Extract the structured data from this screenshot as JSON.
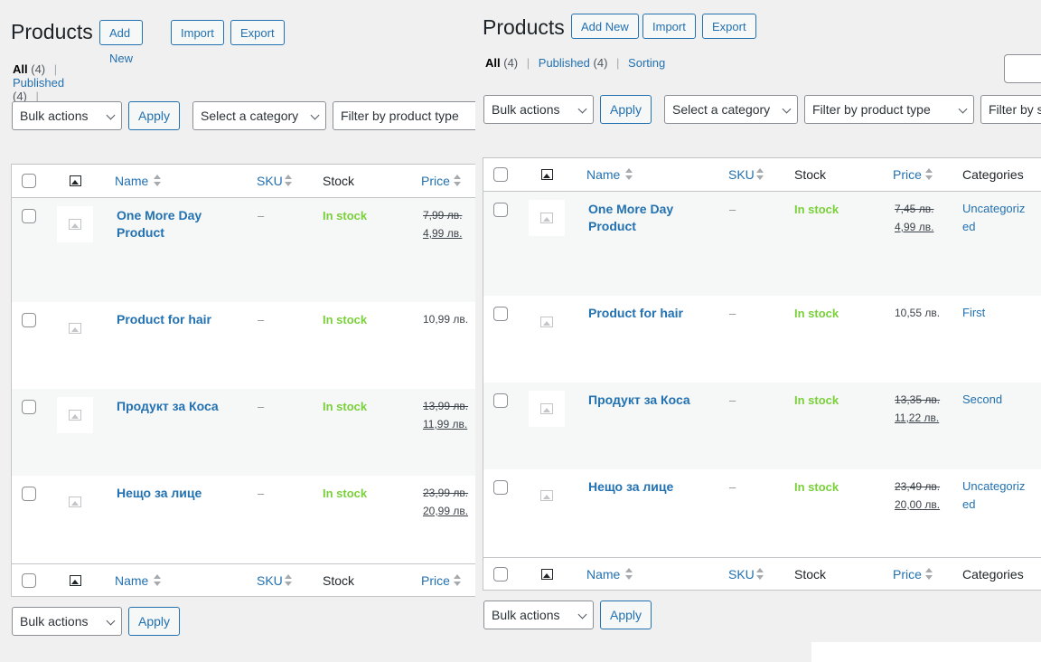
{
  "page": {
    "title": "Products",
    "buttons": {
      "add_new": "Add New",
      "import": "Import",
      "export": "Export"
    },
    "views": {
      "all": "All",
      "all_count": "(4)",
      "published": "Published",
      "published_count": "(4)",
      "sorting": "Sorting",
      "separator": "|"
    },
    "bulk_actions": "Bulk actions",
    "apply": "Apply",
    "filters": {
      "category": "Select a category",
      "product_type": "Filter by product type",
      "stock_status_partial": "Filter by s"
    },
    "columns": {
      "name": "Name",
      "sku": "SKU",
      "stock": "Stock",
      "price": "Price",
      "categories": "Categories"
    }
  },
  "left_table": {
    "rows": [
      {
        "name_line1": "One More Day",
        "name_line2": "Product",
        "sku": "–",
        "stock": "In stock",
        "price_regular": "7,99 лв.",
        "price_sale": "4,99 лв.",
        "price_single": ""
      },
      {
        "name_line1": "Product for hair",
        "name_line2": "",
        "sku": "–",
        "stock": "In stock",
        "price_regular": "",
        "price_sale": "",
        "price_single": "10,99 лв."
      },
      {
        "name_line1": "Продукт за Коса",
        "name_line2": "",
        "sku": "–",
        "stock": "In stock",
        "price_regular": "13,99 лв.",
        "price_sale": "11,99 лв.",
        "price_single": ""
      },
      {
        "name_line1": "Нещо за лице",
        "name_line2": "",
        "sku": "–",
        "stock": "In stock",
        "price_regular": "23,99 лв.",
        "price_sale": "20,99 лв.",
        "price_single": ""
      }
    ]
  },
  "right_table": {
    "rows": [
      {
        "name_line1": "One More Day",
        "name_line2": "Product",
        "sku": "–",
        "stock": "In stock",
        "price_regular": "7,45 лв.",
        "price_sale": "4,99 лв.",
        "price_single": "",
        "category_line1": "Uncategoriz",
        "category_line2": "ed"
      },
      {
        "name_line1": "Product for hair",
        "name_line2": "",
        "sku": "–",
        "stock": "In stock",
        "price_regular": "",
        "price_sale": "",
        "price_single": "10,55 лв.",
        "category_line1": "First",
        "category_line2": ""
      },
      {
        "name_line1": "Продукт за Коса",
        "name_line2": "",
        "sku": "–",
        "stock": "In stock",
        "price_regular": "13,35 лв.",
        "price_sale": "11,22 лв.",
        "price_single": "",
        "category_line1": "Second",
        "category_line2": ""
      },
      {
        "name_line1": "Нещо за лице",
        "name_line2": "",
        "sku": "–",
        "stock": "In stock",
        "price_regular": "23,49 лв.",
        "price_sale": "20,00 лв.",
        "price_single": "",
        "category_line1": "Uncategoriz",
        "category_line2": "ed"
      }
    ]
  },
  "icons": {
    "image_column": "image-icon",
    "thumbnail": "placeholder-image-icon",
    "sort": "sort-arrows-icon",
    "dropdown": "chevron-down-icon"
  },
  "colors": {
    "link": "#2271b1",
    "in_stock": "#7ad03a",
    "background": "#f0f0f1",
    "border": "#c3c4c7"
  }
}
